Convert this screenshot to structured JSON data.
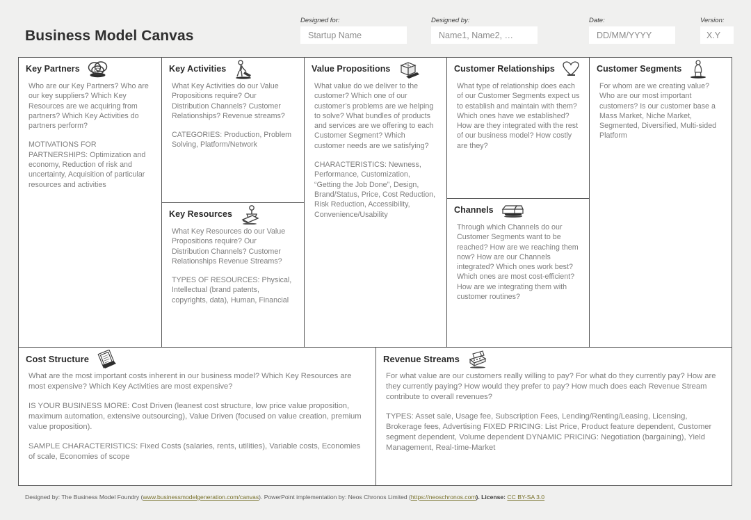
{
  "header": {
    "title": "Business Model Canvas",
    "fields": [
      {
        "label": "Designed for:",
        "value": "Startup Name",
        "name": "designed-for"
      },
      {
        "label": "Designed by:",
        "value": "Name1, Name2, …",
        "name": "designed-by"
      },
      {
        "label": "Date:",
        "value": "DD/MM/YYYY",
        "name": "date"
      },
      {
        "label": "Version:",
        "value": "X.Y",
        "name": "version"
      }
    ]
  },
  "blocks": {
    "key_partners": {
      "title": "Key Partners",
      "icon": "linked-rings-icon",
      "para1": "Who are our Key Partners? Who are our key suppliers? Which Key Resources are we acquiring from partners? Which Key Activities do partners perform?",
      "para2": "MOTIVATIONS FOR PARTNERSHIPS: Optimization and economy, Reduction of risk and uncertainty, Acquisition of particular resources and activities"
    },
    "key_activities": {
      "title": "Key Activities",
      "icon": "worker-sweeping-icon",
      "para1": "What Key Activities do our Value Propositions require? Our Distribution Channels? Customer Relationships? Revenue streams?",
      "para2": "CATEGORIES: Production, Problem Solving, Platform/Network"
    },
    "key_resources": {
      "title": "Key Resources",
      "icon": "stamp-press-icon",
      "para1": "What Key Resources do our Value Propositions require? Our Distribution Channels? Customer Relationships Revenue Streams?",
      "para2": "TYPES OF RESOURCES: Physical, Intellectual (brand patents, copyrights, data), Human, Financial"
    },
    "value_propositions": {
      "title": "Value Propositions",
      "icon": "gift-package-icon",
      "para1": "What value do we deliver to the customer? Which one of our customer’s problems are we helping to solve? What bundles of products and services are we offering to each Customer Segment? Which customer needs are we satisfying?",
      "para2": "CHARACTERISTICS: Newness, Performance, Customization, “Getting the Job Done”, Design, Brand/Status, Price, Cost Reduction, Risk Reduction, Accessibility, Convenience/Usability"
    },
    "customer_relationships": {
      "title": "Customer Relationships",
      "icon": "heart-icon",
      "para1": "What type of relationship does each of our Customer Segments expect us to establish and maintain with them? Which ones have we established? How are they integrated with the rest of our business model? How costly are they?"
    },
    "channels": {
      "title": "Channels",
      "icon": "truck-icon",
      "para1": "Through which Channels do our Customer Segments want to be reached? How are we reaching them now? How are our Channels integrated? Which ones work best? Which ones are most cost-efficient? How are we integrating them with customer routines?"
    },
    "customer_segments": {
      "title": "Customer Segments",
      "icon": "person-standing-icon",
      "para1": "For whom are we creating value? Who are our most important customers? Is our customer base a Mass Market, Niche Market, Segmented, Diversified, Multi-sided Platform"
    },
    "cost_structure": {
      "title": "Cost Structure",
      "icon": "invoice-papers-icon",
      "para1": "What are the most important costs inherent in our business model? Which Key Resources are most expensive? Which Key Activities are most expensive?",
      "para2": "IS YOUR BUSINESS MORE: Cost Driven (leanest cost structure, low price value proposition, maximum automation, extensive outsourcing), Value Driven (focused on value creation, premium value proposition).",
      "para3": "SAMPLE CHARACTERISTICS: Fixed Costs (salaries, rents, utilities), Variable costs, Economies of scale, Economies of scope"
    },
    "revenue_streams": {
      "title": "Revenue Streams",
      "icon": "cash-register-icon",
      "para1": "For what value are our customers really willing to pay? For what do they currently pay? How are they currently paying? How would they prefer to pay? How much does each Revenue Stream contribute to overall revenues?",
      "para2": "TYPES: Asset sale, Usage fee, Subscription Fees, Lending/Renting/Leasing, Licensing, Brokerage fees, Advertising\nFIXED PRICING: List Price, Product feature dependent, Customer segment dependent, Volume dependent\nDYNAMIC PRICING: Negotiation (bargaining), Yield Management, Real-time-Market"
    }
  },
  "footer": {
    "prefix": "Designed by: The Business Model Foundry (",
    "link1": "www.businessmodelgeneration.com/canvas",
    "middle": "). PowerPoint implementation by: Neos Chronos Limited (",
    "link2": "https://neoschronos.com",
    "license_label": "). License: ",
    "license": "CC BY-SA 3.0"
  },
  "colors": {
    "page_background": "#f0f0ef",
    "cell_background": "#ffffff",
    "border": "#555555",
    "body_text": "#7d7d7d",
    "title_text": "#2a2a2a",
    "link": "#77702a"
  }
}
